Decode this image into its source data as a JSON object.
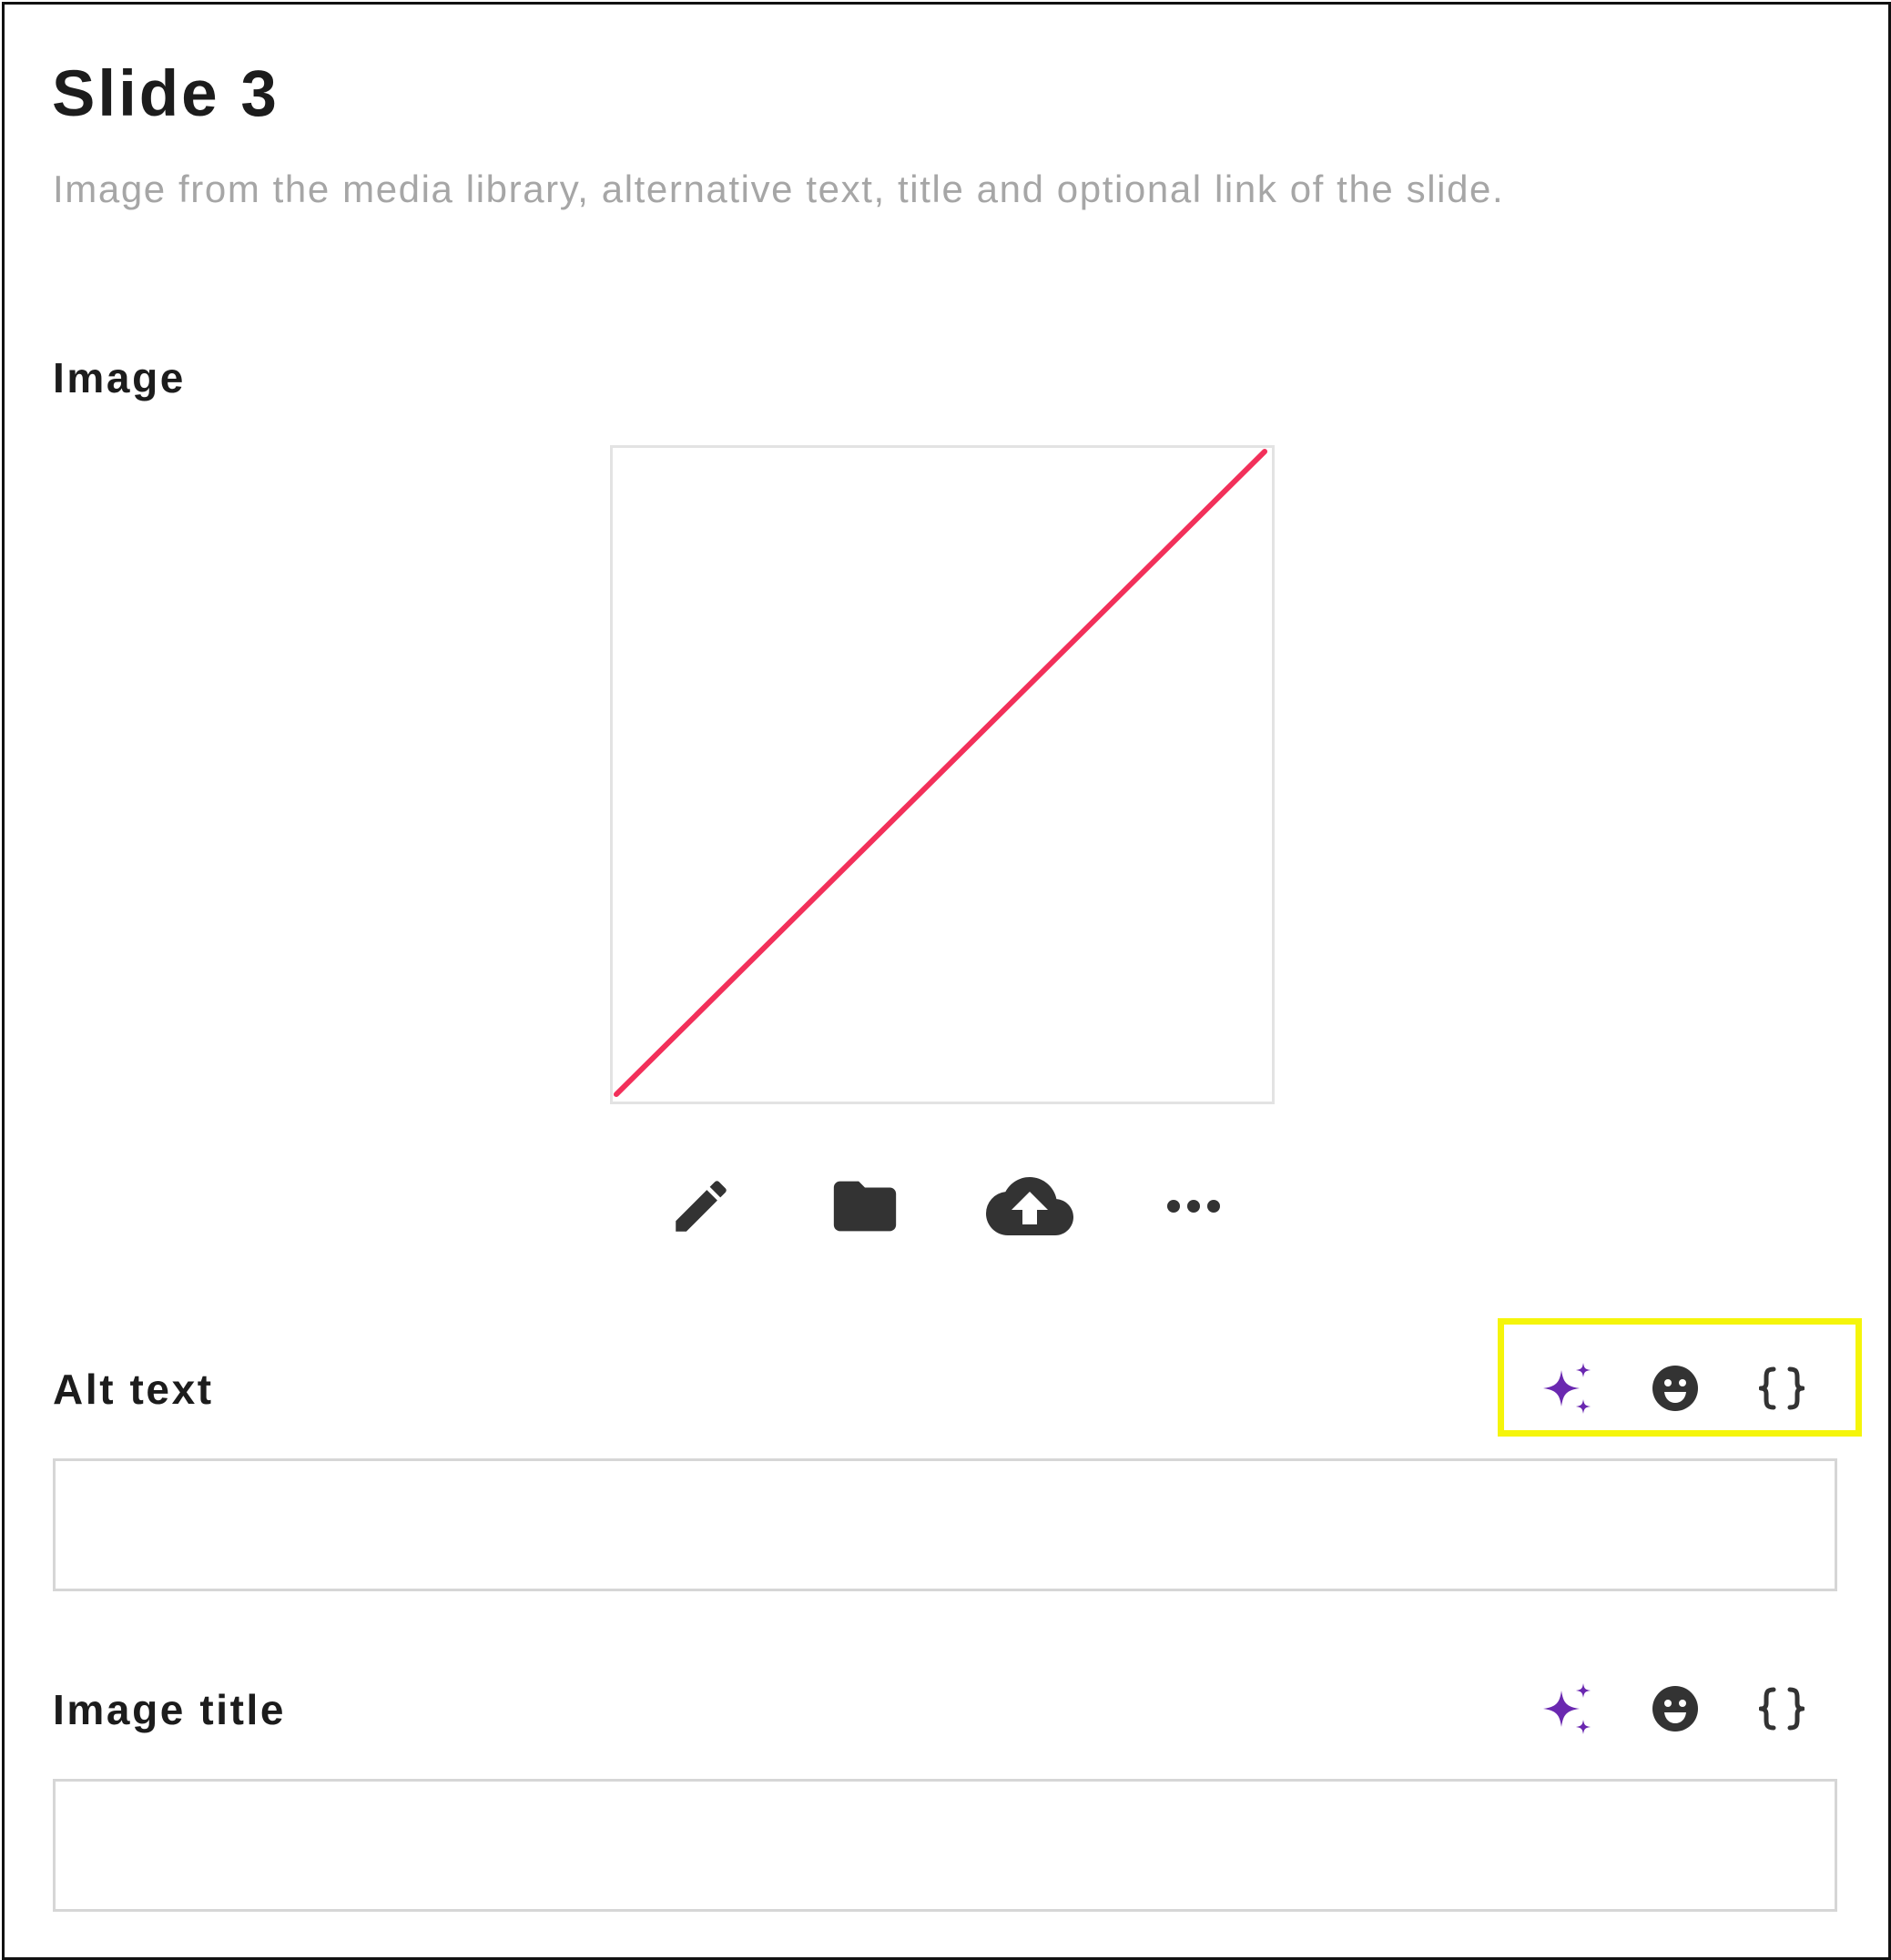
{
  "header": {
    "title": "Slide 3",
    "subtitle": "Image from the media library, alternative text, title and optional link of the slide."
  },
  "image_section": {
    "label": "Image",
    "placeholder_icon": "empty-image-slash",
    "toolbar": [
      {
        "icon": "pencil-icon",
        "action": "edit"
      },
      {
        "icon": "folder-icon",
        "action": "media-library"
      },
      {
        "icon": "cloud-upload-icon",
        "action": "upload"
      },
      {
        "icon": "more-horizontal-icon",
        "action": "more"
      }
    ]
  },
  "alt_text": {
    "label": "Alt text",
    "value": "",
    "actions": [
      "ai-sparkle-icon",
      "emoji-icon",
      "curly-braces-icon"
    ],
    "highlighted": true
  },
  "image_title": {
    "label": "Image title",
    "value": "",
    "actions": [
      "ai-sparkle-icon",
      "emoji-icon",
      "curly-braces-icon"
    ]
  },
  "colors": {
    "placeholder_line": "#f2305a",
    "ai_accent": "#6a28b0",
    "icon": "#333333",
    "highlight": "#f5f50a"
  }
}
